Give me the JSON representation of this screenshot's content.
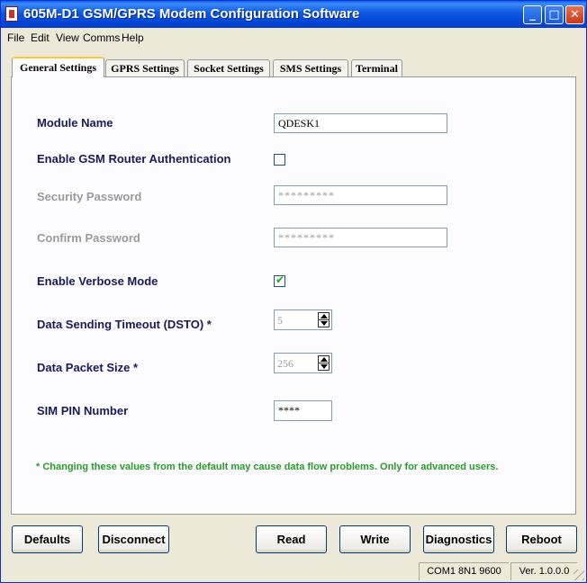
{
  "window": {
    "title": "605M-D1 GSM/GPRS Modem Configuration Software",
    "icon": "app-icon",
    "controls": {
      "minimize": "_",
      "maximize": "□",
      "close": "✕"
    }
  },
  "menu": [
    "File",
    "Edit",
    "View",
    "Comms",
    "Help"
  ],
  "tabs": [
    "General Settings",
    "GPRS Settings",
    "Socket Settings",
    "SMS Settings",
    "Terminal"
  ],
  "active_tab": "General Settings",
  "form": {
    "module_name": {
      "label": "Module Name",
      "value": "QDESK1"
    },
    "enable_auth": {
      "label": "Enable GSM Router Authentication",
      "checked": false
    },
    "security_password": {
      "label": "Security Password",
      "value": "*********",
      "disabled": true
    },
    "confirm_password": {
      "label": "Confirm Password",
      "value": "*********",
      "disabled": true
    },
    "verbose": {
      "label": "Enable Verbose Mode",
      "checked": true
    },
    "dsto": {
      "label": "Data Sending Timeout (DSTO) *",
      "value": "5"
    },
    "packet_size": {
      "label": "Data Packet Size *",
      "value": "256"
    },
    "sim_pin": {
      "label": "SIM PIN Number",
      "value": "****"
    },
    "note": "* Changing these values from the default may cause data flow problems. Only for advanced users."
  },
  "buttons": {
    "defaults": "Defaults",
    "disconnect": "Disconnect",
    "read": "Read",
    "write": "Write",
    "diagnostics": "Diagnostics",
    "reboot": "Reboot"
  },
  "status": {
    "port": "COM1  8N1  9600",
    "version": "Ver. 1.0.0.0"
  },
  "colors": {
    "titlebar": "#0A5FE8",
    "label": "#1a1a5a",
    "note": "#2a9a2a",
    "active_tab_accent": "#FFC83C"
  }
}
